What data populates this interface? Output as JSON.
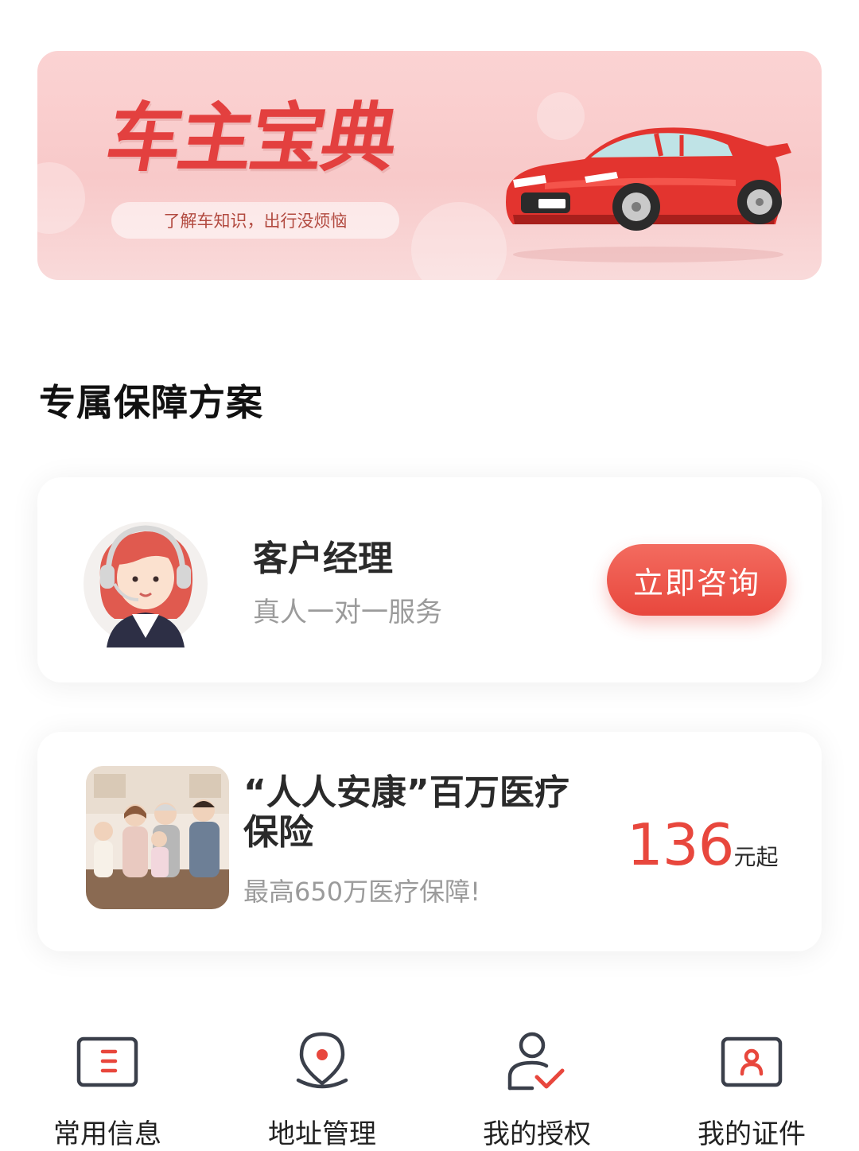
{
  "banner": {
    "title": "车主宝典",
    "subtitle": "了解车知识，出行没烦恼"
  },
  "section": {
    "title": "专属保障方案"
  },
  "manager_card": {
    "title": "客户经理",
    "subtitle": "真人一对一服务",
    "button": "立即咨询"
  },
  "product_card": {
    "title": "“人人安康”百万医疗保险",
    "subtitle": "最高650万医疗保障!",
    "price": "136",
    "price_unit": "元起"
  },
  "shortcuts": [
    {
      "label": "常用信息",
      "icon": "info-card-icon"
    },
    {
      "label": "地址管理",
      "icon": "location-pin-icon"
    },
    {
      "label": "我的授权",
      "icon": "user-check-icon"
    },
    {
      "label": "我的证件",
      "icon": "id-card-icon"
    }
  ],
  "colors": {
    "accent": "#e8473d",
    "banner_bg": "#f8c9c9",
    "icon_gray": "#3a3f4a"
  }
}
